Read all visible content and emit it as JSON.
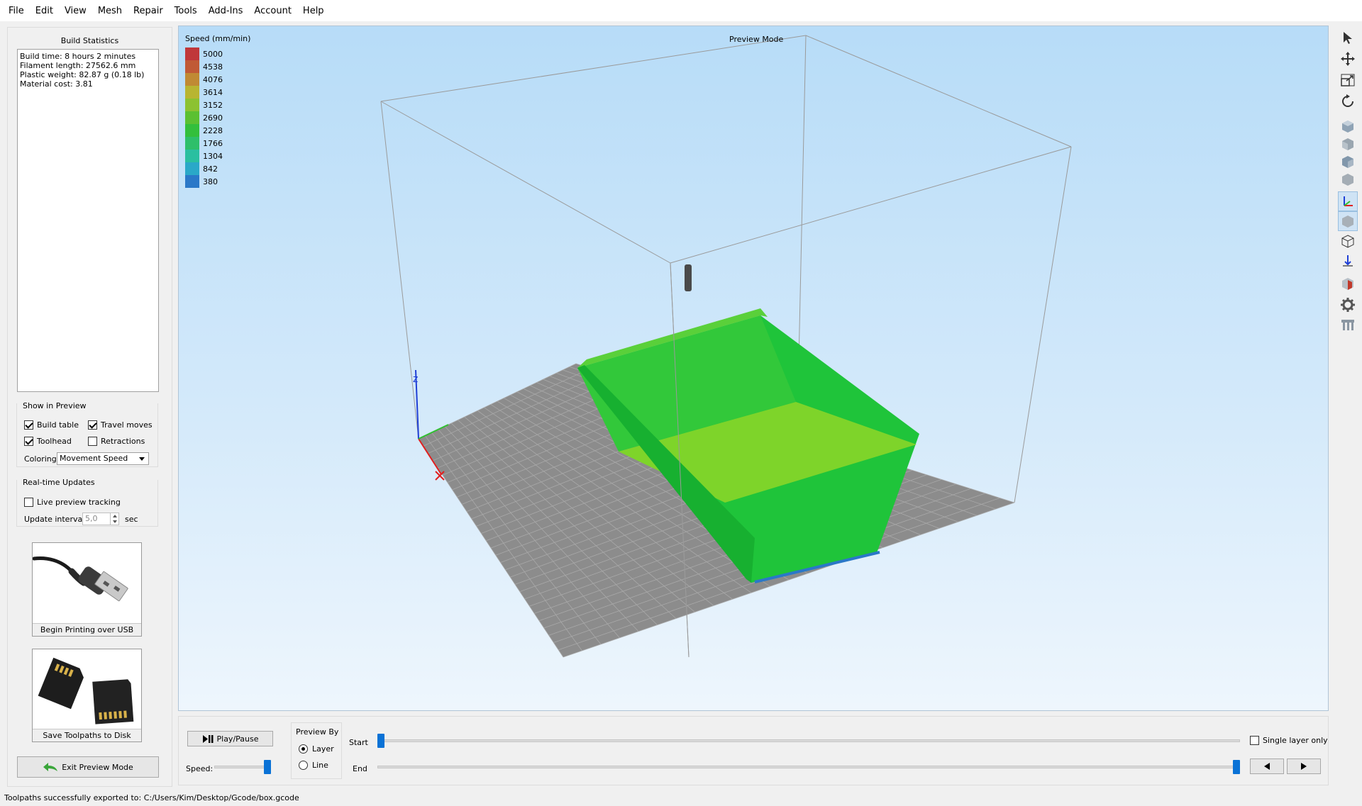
{
  "menu": [
    "File",
    "Edit",
    "View",
    "Mesh",
    "Repair",
    "Tools",
    "Add-Ins",
    "Account",
    "Help"
  ],
  "build_stats": {
    "title": "Build Statistics",
    "lines": [
      "Build time: 8 hours 2 minutes",
      "Filament length: 27562.6 mm",
      "Plastic weight: 82.87 g (0.18 lb)",
      "Material cost: 3.81"
    ]
  },
  "show_in_preview": {
    "title": "Show in Preview",
    "build_table": {
      "label": "Build table",
      "checked": true
    },
    "travel_moves": {
      "label": "Travel moves",
      "checked": true
    },
    "toolhead": {
      "label": "Toolhead",
      "checked": true
    },
    "retractions": {
      "label": "Retractions",
      "checked": false
    },
    "coloring_label": "Coloring",
    "coloring_value": "Movement Speed"
  },
  "realtime": {
    "title": "Real-time Updates",
    "live_preview": {
      "label": "Live preview tracking",
      "checked": false
    },
    "interval_label": "Update interval",
    "interval_value": "5,0",
    "interval_unit": "sec"
  },
  "usb_card_label": "Begin Printing over USB",
  "sd_card_label": "Save Toolpaths to Disk",
  "exit_button": "Exit Preview Mode",
  "viewport": {
    "legend_title": "Speed (mm/min)",
    "mode_label": "Preview Mode",
    "legend": [
      {
        "label": "5000",
        "color": "#c0373a"
      },
      {
        "label": "4538",
        "color": "#c05a36"
      },
      {
        "label": "4076",
        "color": "#c08a34"
      },
      {
        "label": "3614",
        "color": "#b8b532"
      },
      {
        "label": "3152",
        "color": "#8cc232"
      },
      {
        "label": "2690",
        "color": "#5bc032"
      },
      {
        "label": "2228",
        "color": "#33bf3c"
      },
      {
        "label": "1766",
        "color": "#2ebf6a"
      },
      {
        "label": "1304",
        "color": "#2abfa0"
      },
      {
        "label": "842",
        "color": "#2aa8c8"
      },
      {
        "label": "380",
        "color": "#2a78c8"
      }
    ],
    "model_color": "#1fc43a",
    "model_top_color": "#7ed42a"
  },
  "bottom": {
    "play_pause": "Play/Pause",
    "speed_label": "Speed:",
    "preview_by_title": "Preview By",
    "layer_label": "Layer",
    "line_label": "Line",
    "start_label": "Start",
    "end_label": "End",
    "single_layer_label": "Single layer only",
    "speed_level": 1.0,
    "start_level": 0.0,
    "end_level": 1.0
  },
  "status": "Toolpaths successfully exported to: C:/Users/Kim/Desktop/Gcode/box.gcode",
  "accent_color": "#0a72d6"
}
